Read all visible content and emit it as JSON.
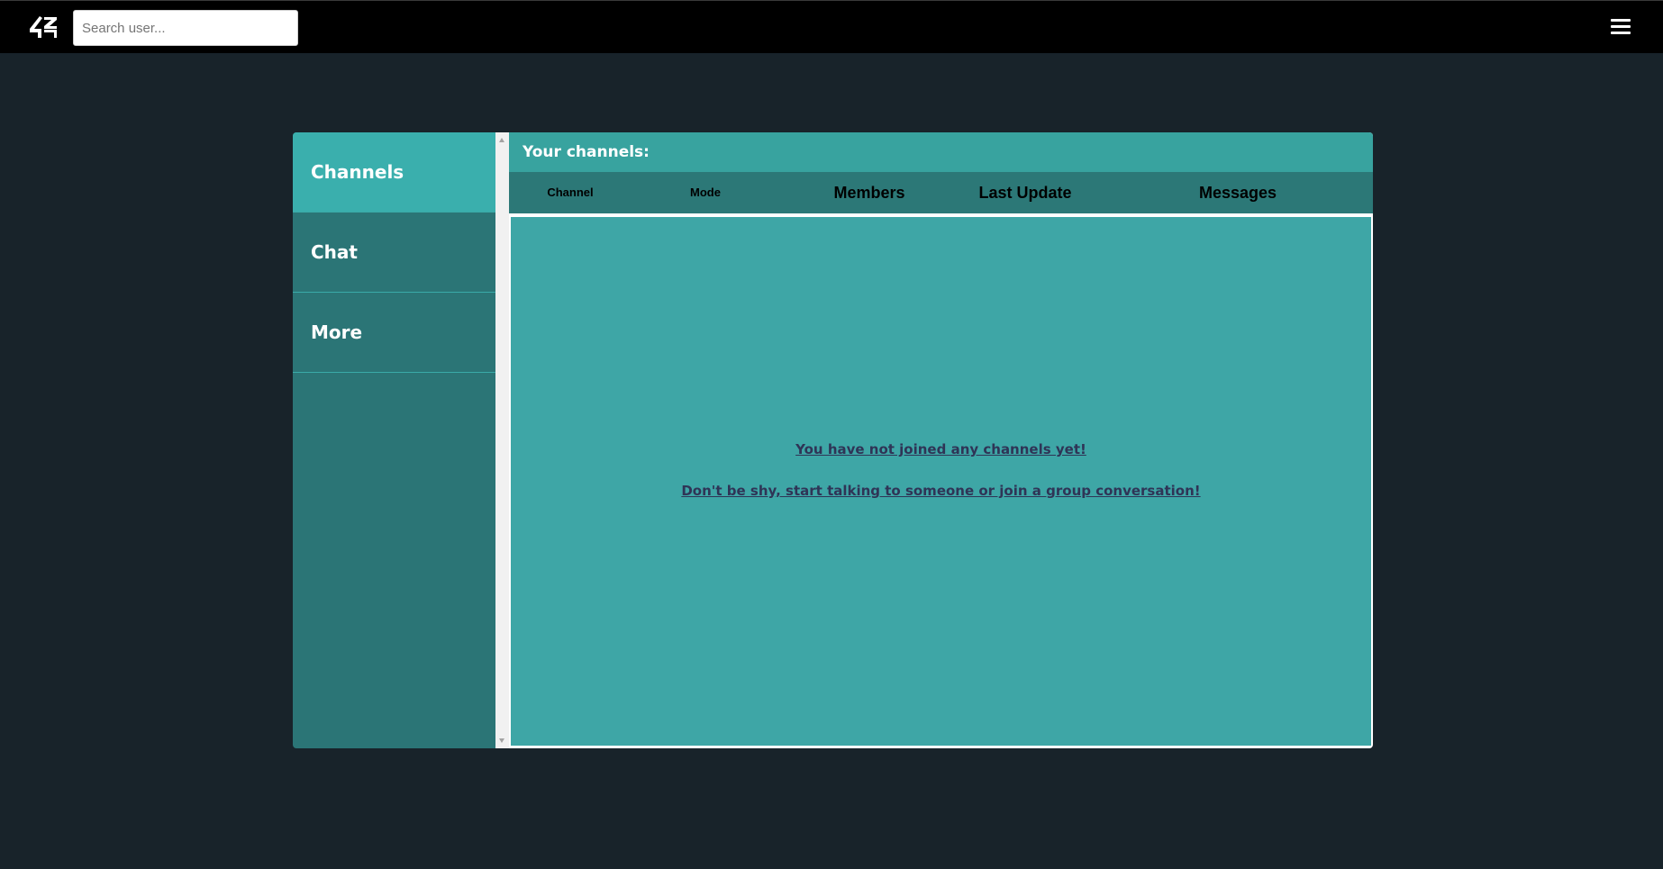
{
  "header": {
    "logo_text": "42",
    "search_placeholder": "Search user...",
    "menu_icon": "hamburger-icon"
  },
  "sidebar": {
    "items": [
      {
        "label": "Channels",
        "active": true
      },
      {
        "label": "Chat",
        "active": false
      },
      {
        "label": "More",
        "active": false
      }
    ]
  },
  "main": {
    "title": "Your channels:",
    "columns": [
      "Channel",
      "Mode",
      "Members",
      "Last Update",
      "Messages"
    ],
    "empty_line_1": "You have not joined any channels yet!",
    "empty_line_2": "Don't be shy, start talking to someone or join a group conversation!"
  },
  "colors": {
    "page_background": "#18232a",
    "header_background": "#000000",
    "sidebar_background": "#2b7576",
    "sidebar_active": "#3aafad",
    "title_bar": "#38a39f",
    "table_header": "#2c7877",
    "content_background": "#3ea6a6",
    "link_text": "#2f3456"
  }
}
